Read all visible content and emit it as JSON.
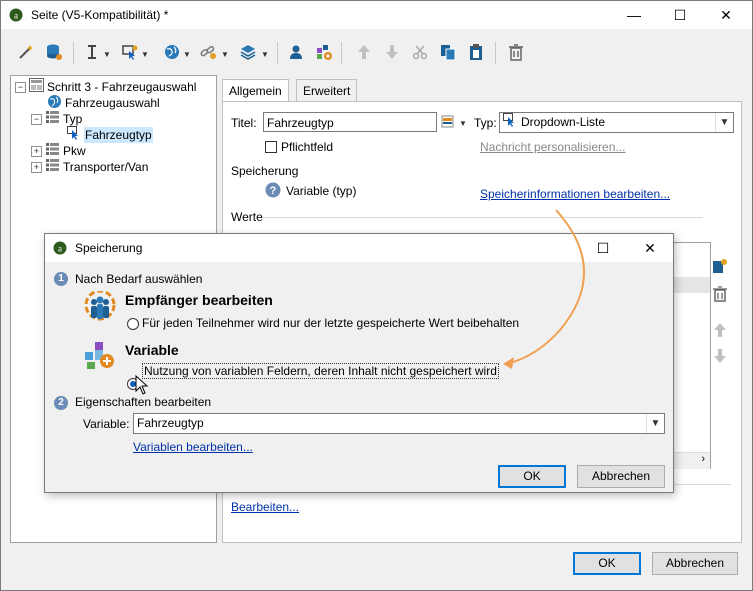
{
  "window": {
    "title": "Seite (V5-Kompatibilität) *",
    "minimize_glyph": "—",
    "maximize_glyph": "☐",
    "close_glyph": "✕"
  },
  "tree": {
    "root": "Schritt 3 - Fahrzeugauswahl",
    "items": [
      {
        "label": "Fahrzeugauswahl",
        "icon": "globe-icon"
      },
      {
        "label": "Typ",
        "icon": "list-icon"
      },
      {
        "label": "Fahrzeugtyp",
        "icon": "cursor-icon"
      },
      {
        "label": "Pkw",
        "icon": "list-icon"
      },
      {
        "label": "Transporter/Van",
        "icon": "list-icon"
      }
    ],
    "expander_minus": "−",
    "expander_plus": "+"
  },
  "tabs": {
    "general": "Allgemein",
    "advanced": "Erweitert"
  },
  "form": {
    "title_label": "Titel:",
    "title_value": "Fahrzeugtyp",
    "type_label": "Typ:",
    "type_value": "Dropdown-Liste",
    "required_label": "Pflichtfeld",
    "personalize_link": "Nachricht personalisieren...",
    "storage_heading": "Speicherung",
    "variable_text": "Variable (typ)",
    "edit_storage_link": "Speicherinformationen bearbeiten...",
    "values_heading": "Werte",
    "edit_link": "Bearbeiten..."
  },
  "dialog": {
    "title": "Speicherung",
    "step1_num": "1",
    "step1_label": "Nach Bedarf auswählen",
    "recipient_heading": "Empfänger bearbeiten",
    "recipient_option": "Für jeden Teilnehmer wird nur der letzte gespeicherte Wert beibehalten",
    "variable_heading": "Variable",
    "variable_option": "Nutzung von variablen Feldern, deren Inhalt nicht gespeichert wird",
    "step2_num": "2",
    "step2_label": "Eigenschaften bearbeiten",
    "variable_label": "Variable:",
    "variable_value": "Fahrzeugtyp",
    "edit_variables_link": "Variablen bearbeiten...",
    "ok": "OK",
    "cancel": "Abbrechen",
    "maximize_glyph": "☐",
    "close_glyph": "✕"
  },
  "footer": {
    "ok": "OK",
    "cancel": "Abbrechen"
  },
  "colors": {
    "accent": "#0078d7",
    "arrow": "#f0a050",
    "link": "#0033aa"
  }
}
